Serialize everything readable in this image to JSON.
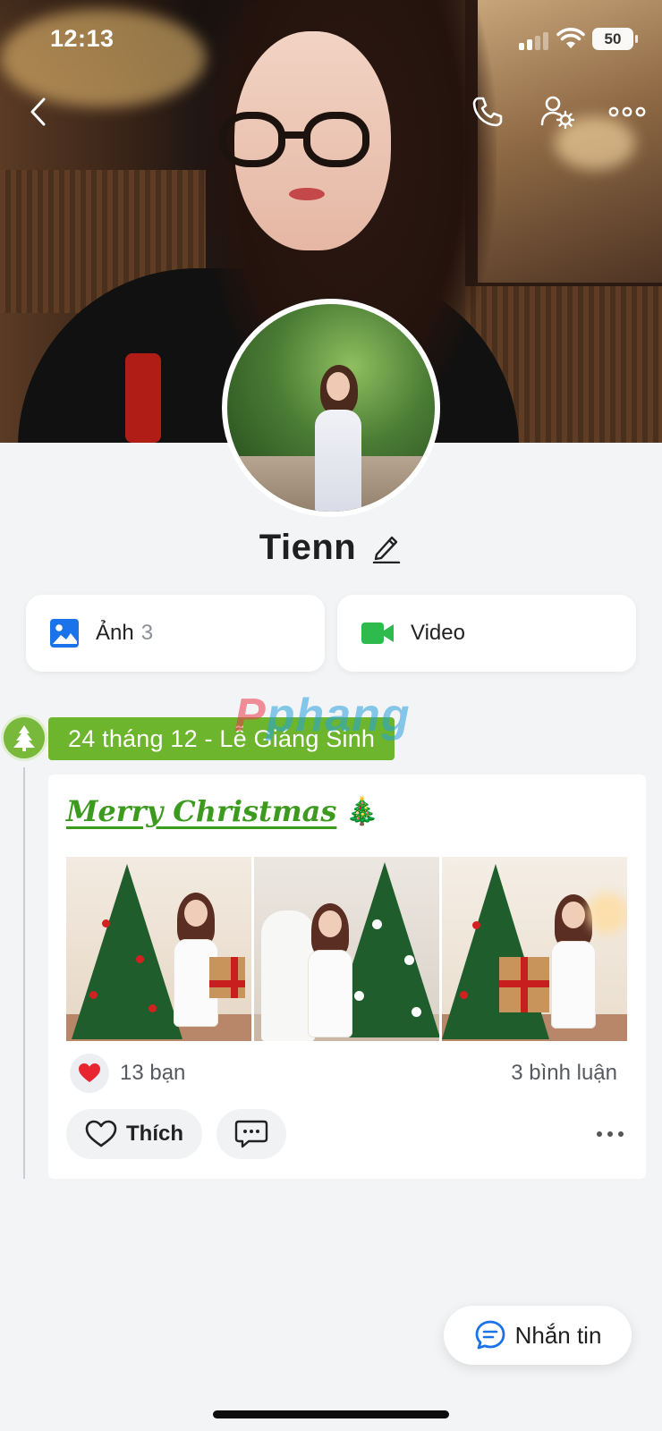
{
  "status_bar": {
    "time": "12:13",
    "battery": "50",
    "icons": [
      "signal-icon",
      "wifi-icon",
      "battery-icon"
    ]
  },
  "top_nav": {
    "icons": [
      "chevron-left-icon",
      "phone-icon",
      "user-settings-icon",
      "more-horizontal-icon"
    ]
  },
  "profile": {
    "name": "Tienn",
    "edit_icon": "pencil-icon"
  },
  "media": {
    "photos": {
      "label": "Ảnh",
      "count": "3",
      "icon": "image-icon",
      "color": "#1a73e8"
    },
    "videos": {
      "label": "Video",
      "icon": "video-camera-icon",
      "color": "#2fba4e"
    }
  },
  "post": {
    "date_tag": "24 tháng 12 - Lễ Giáng Sinh",
    "badge_icon": "christmas-tree-icon",
    "title": "Merry Christmas",
    "title_emoji": "🎄",
    "photos_count": 3,
    "reaction_icon": "heart-icon",
    "likes": "13 bạn",
    "comments": "3 bình luận",
    "like_label": "Thích",
    "comment_icon": "chat-bubble-icon",
    "more_icon": "more-horizontal-icon"
  },
  "watermark": {
    "part1": "P",
    "part2": "phang"
  },
  "message_button": {
    "label": "Nhắn tin",
    "icon": "chat-bubble-icon"
  },
  "colors": {
    "accent_green": "#6cb52d",
    "title_green": "#3c9a1e",
    "like_red": "#e8262f",
    "background": "#f3f4f6"
  }
}
